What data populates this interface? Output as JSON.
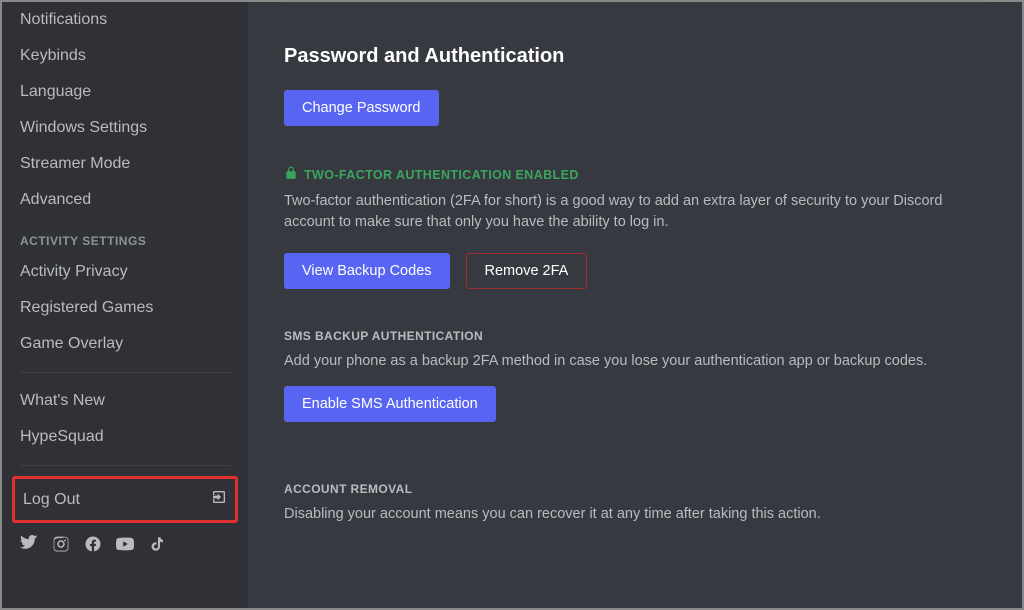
{
  "sidebar": {
    "items": [
      {
        "label": "Notifications"
      },
      {
        "label": "Keybinds"
      },
      {
        "label": "Language"
      },
      {
        "label": "Windows Settings"
      },
      {
        "label": "Streamer Mode"
      },
      {
        "label": "Advanced"
      }
    ],
    "activity_header": "Activity Settings",
    "activity_items": [
      {
        "label": "Activity Privacy"
      },
      {
        "label": "Registered Games"
      },
      {
        "label": "Game Overlay"
      }
    ],
    "extra_items": [
      {
        "label": "What's New"
      },
      {
        "label": "HypeSquad"
      }
    ],
    "logout": "Log Out"
  },
  "main": {
    "title": "Password and Authentication",
    "change_password": "Change Password",
    "twofa": {
      "header": "Two-Factor Authentication Enabled",
      "desc": "Two-factor authentication (2FA for short) is a good way to add an extra layer of security to your Discord account to make sure that only you have the ability to log in.",
      "view_backup": "View Backup Codes",
      "remove_2fa": "Remove 2FA"
    },
    "sms": {
      "header": "SMS Backup Authentication",
      "desc": "Add your phone as a backup 2FA method in case you lose your authentication app or backup codes.",
      "button": "Enable SMS Authentication"
    },
    "removal": {
      "header": "Account Removal",
      "desc": "Disabling your account means you can recover it at any time after taking this action."
    }
  }
}
